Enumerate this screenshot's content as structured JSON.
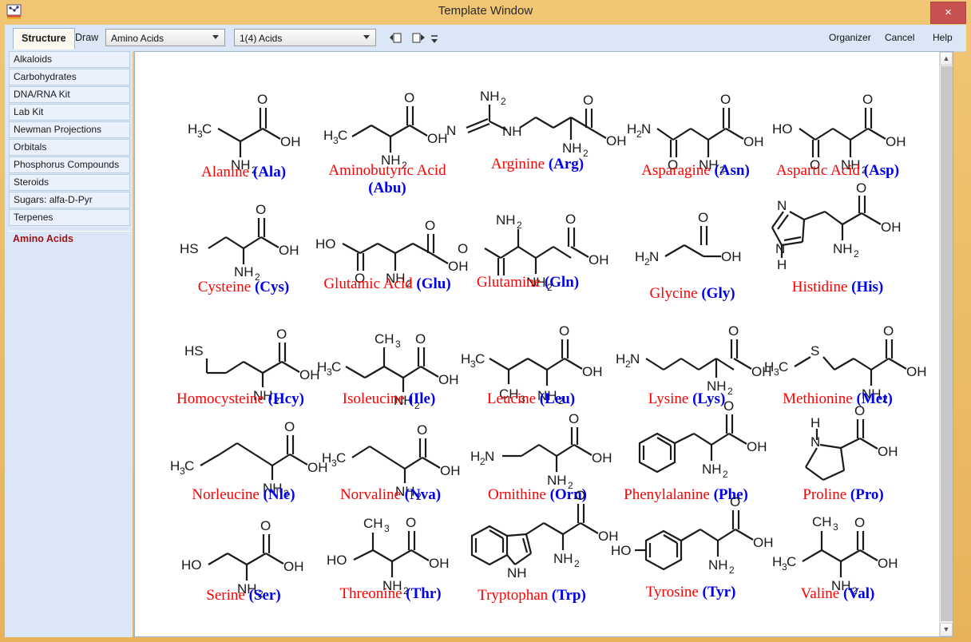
{
  "window": {
    "title": "Template Window",
    "close_label": "×",
    "icon": "app-icon"
  },
  "toolbar": {
    "tab_structure": "Structure",
    "tab_draw": "Draw",
    "template_combo": "Amino Acids",
    "page_combo": "1(4) Acids",
    "nav_prev_icon": "nav-prev-icon",
    "nav_next_icon": "nav-next-icon",
    "nav_more_icon": "nav-more-icon",
    "organizer": "Organizer",
    "cancel": "Cancel",
    "help": "Help"
  },
  "sidebar": {
    "items": [
      {
        "label": "Alkaloids",
        "selected": false
      },
      {
        "label": "Carbohydrates",
        "selected": false
      },
      {
        "label": "DNA/RNA Kit",
        "selected": false
      },
      {
        "label": "Lab Kit",
        "selected": false
      },
      {
        "label": "Newman Projections",
        "selected": false
      },
      {
        "label": "Orbitals",
        "selected": false
      },
      {
        "label": "Phosphorus Compounds",
        "selected": false
      },
      {
        "label": "Steroids",
        "selected": false
      },
      {
        "label": "Sugars: alfa-D-Pyr",
        "selected": false
      },
      {
        "label": "Terpenes",
        "selected": false
      },
      {
        "label": "Amino Acids",
        "selected": true
      }
    ]
  },
  "scrollbar": {
    "up_icon": "chevron-up-icon",
    "down_icon": "chevron-down-icon"
  },
  "colors": {
    "title_bar": "#efc473",
    "toolbar": "#dbe7f7",
    "name": "#ff0000",
    "abbrev": "#0000ee",
    "selected_item": "#a01414",
    "close_button": "#c75050"
  },
  "molecules": [
    {
      "name": "Alanine ",
      "abbr": "(Ala)"
    },
    {
      "name": "Aminobutyric Acid ",
      "abbr": "(Abu)"
    },
    {
      "name": "Arginine ",
      "abbr": "(Arg)"
    },
    {
      "name": "Asparagine ",
      "abbr": "(Asn)"
    },
    {
      "name": "Aspartic Acid ",
      "abbr": "(Asp)"
    },
    {
      "name": "Cysteine ",
      "abbr": "(Cys)"
    },
    {
      "name": "Glutamic Acid  ",
      "abbr": "(Glu)"
    },
    {
      "name": "Glutamine ",
      "abbr": "(Gln)"
    },
    {
      "name": "Glycine ",
      "abbr": "(Gly)"
    },
    {
      "name": "Histidine ",
      "abbr": "(His)"
    },
    {
      "name": "Homocysteine ",
      "abbr": "(Hcy)"
    },
    {
      "name": "Isoleucine ",
      "abbr": "(Ile)"
    },
    {
      "name": "Leucine ",
      "abbr": "(Leu)"
    },
    {
      "name": "Lysine ",
      "abbr": "(Lys)"
    },
    {
      "name": "Methionine ",
      "abbr": "(Met)"
    },
    {
      "name": "Norleucine ",
      "abbr": "(Nle)"
    },
    {
      "name": "Norvaline ",
      "abbr": "(Nva)"
    },
    {
      "name": "Ornithine ",
      "abbr": "(Orn)"
    },
    {
      "name": "Phenylalanine ",
      "abbr": "(Phe)"
    },
    {
      "name": "Proline ",
      "abbr": "(Pro)"
    },
    {
      "name": "Serine ",
      "abbr": "(Ser)"
    },
    {
      "name": "Threonine ",
      "abbr": "(Thr)"
    },
    {
      "name": "Tryptophan ",
      "abbr": "(Trp)"
    },
    {
      "name": "Tyrosine ",
      "abbr": "(Tyr)"
    },
    {
      "name": "Valine ",
      "abbr": "(Val)"
    }
  ],
  "atom_labels": {
    "ch3": "CH",
    "h3c": "H",
    "oh": "OH",
    "nh2": "NH",
    "o": "O",
    "n": "N",
    "h": "H",
    "s": "S",
    "hs": "HS",
    "ho": "HO",
    "nh": "NH",
    "hn": "HN",
    "h2n": "H"
  }
}
